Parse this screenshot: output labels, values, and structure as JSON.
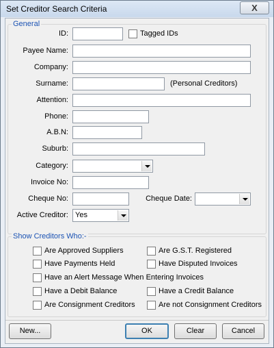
{
  "window": {
    "title": "Set Creditor Search Criteria",
    "close_glyph": "X"
  },
  "general": {
    "legend": "General",
    "id_label": "ID:",
    "id_value": "",
    "tagged_ids_label": "Tagged IDs",
    "payee_name_label": "Payee Name:",
    "company_label": "Company:",
    "surname_label": "Surname:",
    "surname_note": "(Personal Creditors)",
    "attention_label": "Attention:",
    "phone_label": "Phone:",
    "abn_label": "A.B.N:",
    "suburb_label": "Suburb:",
    "category_label": "Category:",
    "category_value": "",
    "invoice_no_label": "Invoice No:",
    "cheque_no_label": "Cheque No:",
    "cheque_date_label": "Cheque Date:",
    "cheque_date_value": "",
    "active_creditor_label": "Active Creditor:",
    "active_creditor_value": "Yes"
  },
  "show": {
    "legend": "Show Creditors Who:-",
    "approved_suppliers": "Are Approved Suppliers",
    "gst_registered": "Are G.S.T. Registered",
    "payments_held": "Have Payments Held",
    "disputed_invoices": "Have Disputed Invoices",
    "alert_message": "Have an Alert Message When Entering Invoices",
    "debit_balance": "Have a Debit Balance",
    "credit_balance": "Have a Credit Balance",
    "consignment": "Are Consignment Creditors",
    "not_consignment": "Are not Consignment Creditors"
  },
  "buttons": {
    "new": "New...",
    "ok": "OK",
    "clear": "Clear",
    "cancel": "Cancel"
  }
}
